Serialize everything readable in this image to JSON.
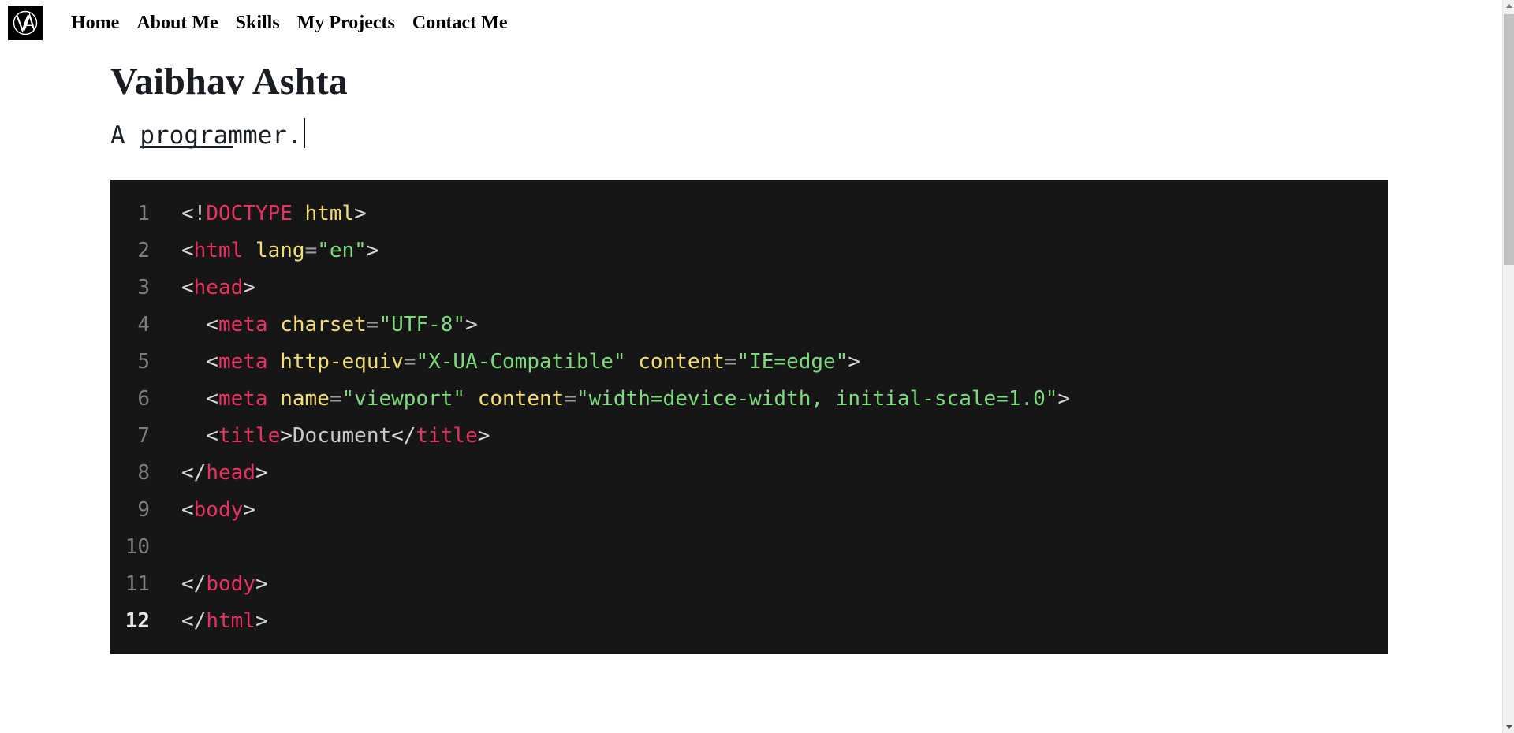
{
  "navbar": {
    "logo": {
      "name": "va-monogram-logo",
      "letters": "VA",
      "background": "#000000",
      "foreground": "#ffffff"
    },
    "links": [
      {
        "label": "Home"
      },
      {
        "label": "About Me"
      },
      {
        "label": "Skills"
      },
      {
        "label": "My Projects"
      },
      {
        "label": "Contact Me"
      }
    ]
  },
  "hero": {
    "name": "Vaibhav Ashta",
    "subtitle_prefix": "A ",
    "subtitle_typed": "programmer",
    "subtitle_suffix": ".",
    "caret": ""
  },
  "code_block": {
    "background": "#161616",
    "language": "html",
    "active_line": 12,
    "colors": {
      "tag": "#e8315f",
      "attribute": "#f2dd72",
      "string": "#7ddb7d",
      "punctuation": "#d6d6d6",
      "text": "#c8c8c8",
      "line_number": "#7d7d7d",
      "line_number_active": "#e6e6e6"
    },
    "lines": [
      {
        "number": "1",
        "tokens": [
          {
            "t": "<!",
            "c": "punct"
          },
          {
            "t": "DOCTYPE",
            "c": "tag"
          },
          {
            "t": " ",
            "c": "punct"
          },
          {
            "t": "html",
            "c": "attr"
          },
          {
            "t": ">",
            "c": "punct"
          }
        ]
      },
      {
        "number": "2",
        "tokens": [
          {
            "t": "<",
            "c": "punct"
          },
          {
            "t": "html",
            "c": "tag"
          },
          {
            "t": " ",
            "c": "punct"
          },
          {
            "t": "lang",
            "c": "attr"
          },
          {
            "t": "=",
            "c": "eq"
          },
          {
            "t": "\"en\"",
            "c": "str"
          },
          {
            "t": ">",
            "c": "punct"
          }
        ]
      },
      {
        "number": "3",
        "tokens": [
          {
            "t": "<",
            "c": "punct"
          },
          {
            "t": "head",
            "c": "tag"
          },
          {
            "t": ">",
            "c": "punct"
          }
        ]
      },
      {
        "number": "4",
        "tokens": [
          {
            "t": "  <",
            "c": "punct"
          },
          {
            "t": "meta",
            "c": "tag"
          },
          {
            "t": " ",
            "c": "punct"
          },
          {
            "t": "charset",
            "c": "attr"
          },
          {
            "t": "=",
            "c": "eq"
          },
          {
            "t": "\"UTF-8\"",
            "c": "str"
          },
          {
            "t": ">",
            "c": "punct"
          }
        ]
      },
      {
        "number": "5",
        "tokens": [
          {
            "t": "  <",
            "c": "punct"
          },
          {
            "t": "meta",
            "c": "tag"
          },
          {
            "t": " ",
            "c": "punct"
          },
          {
            "t": "http-equiv",
            "c": "attr"
          },
          {
            "t": "=",
            "c": "eq"
          },
          {
            "t": "\"X-UA-Compatible\"",
            "c": "str"
          },
          {
            "t": " ",
            "c": "punct"
          },
          {
            "t": "content",
            "c": "attr"
          },
          {
            "t": "=",
            "c": "eq"
          },
          {
            "t": "\"IE=edge\"",
            "c": "str"
          },
          {
            "t": ">",
            "c": "punct"
          }
        ]
      },
      {
        "number": "6",
        "tokens": [
          {
            "t": "  <",
            "c": "punct"
          },
          {
            "t": "meta",
            "c": "tag"
          },
          {
            "t": " ",
            "c": "punct"
          },
          {
            "t": "name",
            "c": "attr"
          },
          {
            "t": "=",
            "c": "eq"
          },
          {
            "t": "\"viewport\"",
            "c": "str"
          },
          {
            "t": " ",
            "c": "punct"
          },
          {
            "t": "content",
            "c": "attr"
          },
          {
            "t": "=",
            "c": "eq"
          },
          {
            "t": "\"width=device-width, initial-scale=1.0\"",
            "c": "str"
          },
          {
            "t": ">",
            "c": "punct"
          }
        ]
      },
      {
        "number": "7",
        "tokens": [
          {
            "t": "  <",
            "c": "punct"
          },
          {
            "t": "title",
            "c": "tag"
          },
          {
            "t": ">",
            "c": "punct"
          },
          {
            "t": "Document",
            "c": "txt"
          },
          {
            "t": "</",
            "c": "punct"
          },
          {
            "t": "title",
            "c": "tag"
          },
          {
            "t": ">",
            "c": "punct"
          }
        ]
      },
      {
        "number": "8",
        "tokens": [
          {
            "t": "</",
            "c": "punct"
          },
          {
            "t": "head",
            "c": "tag"
          },
          {
            "t": ">",
            "c": "punct"
          }
        ]
      },
      {
        "number": "9",
        "tokens": [
          {
            "t": "<",
            "c": "punct"
          },
          {
            "t": "body",
            "c": "tag"
          },
          {
            "t": ">",
            "c": "punct"
          }
        ]
      },
      {
        "number": "10",
        "tokens": []
      },
      {
        "number": "11",
        "tokens": [
          {
            "t": "</",
            "c": "punct"
          },
          {
            "t": "body",
            "c": "tag"
          },
          {
            "t": ">",
            "c": "punct"
          }
        ]
      },
      {
        "number": "12",
        "tokens": [
          {
            "t": "</",
            "c": "punct"
          },
          {
            "t": "html",
            "c": "tag"
          },
          {
            "t": ">",
            "c": "punct"
          }
        ]
      }
    ]
  },
  "scrollbar": {
    "up_arrow": "scroll-up",
    "down_arrow": "scroll-down"
  }
}
